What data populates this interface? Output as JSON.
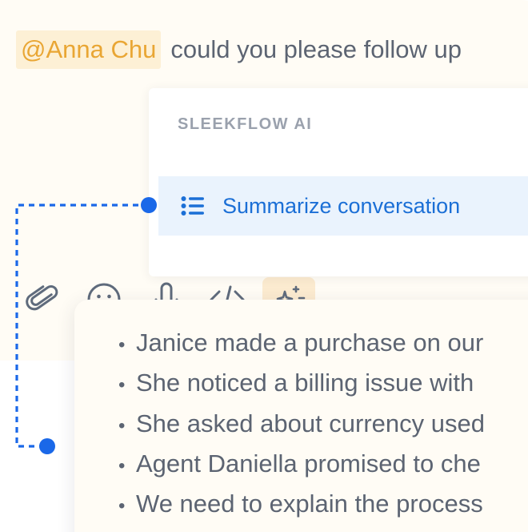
{
  "composer": {
    "mention": "@Anna Chu",
    "message": "could you please follow up"
  },
  "ai_menu": {
    "header": "SLEEKFLOW AI",
    "option_icon": "list-icon",
    "option_label": "Summarize conversation"
  },
  "toolbar": {
    "icons": [
      "paperclip-icon",
      "smiley-icon",
      "microphone-icon",
      "code-icon",
      "ai-sparkle-icon"
    ]
  },
  "summary": {
    "bullet": "•",
    "items": [
      "Janice made a purchase on our",
      "She noticed a billing issue with",
      "She asked about currency used",
      "Agent Daniella promised to che",
      "We need to explain the process"
    ]
  },
  "colors": {
    "accent_blue": "#1b6fd6",
    "mention_text": "#e9a634",
    "mention_bg": "#fdf0d5",
    "cream_bg": "#fffcf5",
    "text_gray": "#5c6472",
    "connector_blue": "#1a68e8"
  }
}
